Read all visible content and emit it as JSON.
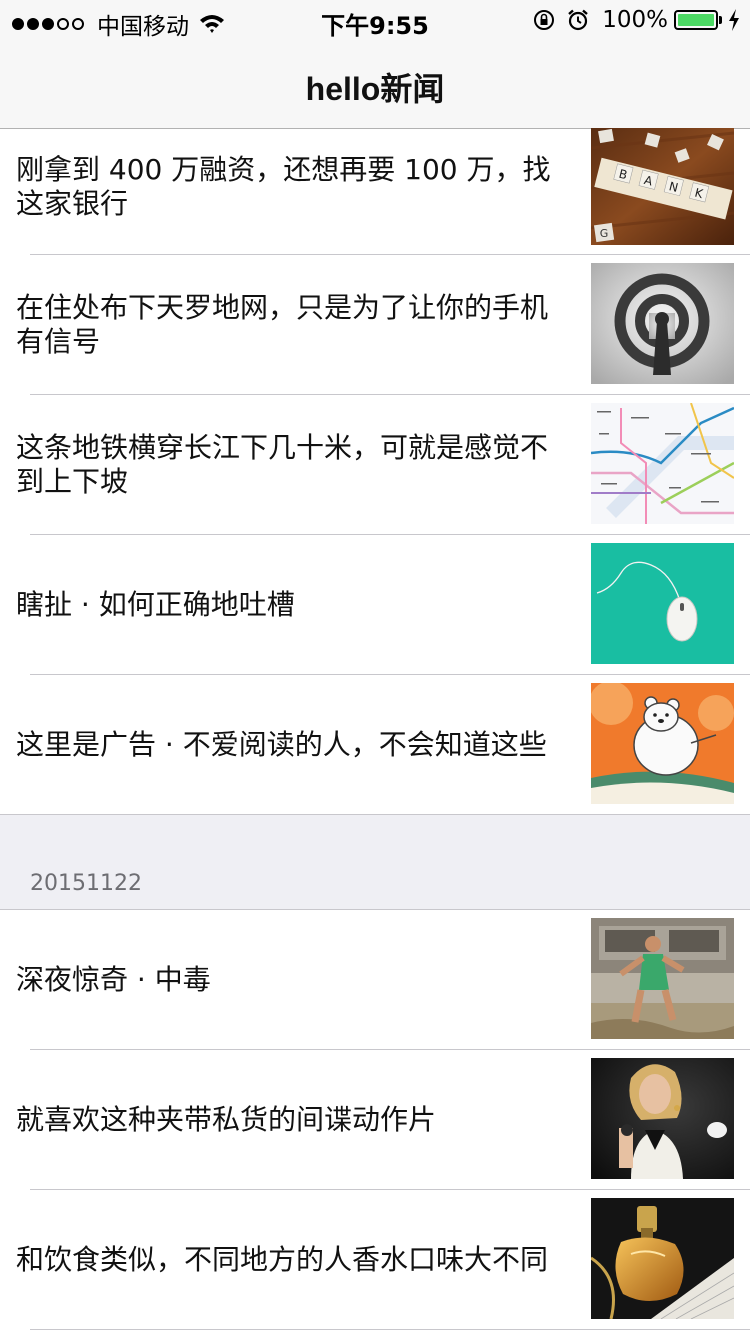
{
  "status_bar": {
    "carrier": "中国移动",
    "time": "下午9:55",
    "battery": "100%",
    "battery_level": 1.0,
    "signal_bars": 3,
    "signal_total": 5,
    "battery_color": "#4cd964"
  },
  "nav": {
    "title": "hello新闻"
  },
  "sections": [
    {
      "header": "",
      "items": [
        {
          "title": "刚拿到 400 万融资，还想再要 100 万，找这家银行",
          "thumb": "bank-tiles-image"
        },
        {
          "title": "在住处布下天罗地网，只是为了让你的手机有信号",
          "thumb": "signal-antenna-image"
        },
        {
          "title": "这条地铁横穿长江下几十米，可就是感觉不到上下坡",
          "thumb": "subway-map-image"
        },
        {
          "title": "瞎扯 · 如何正确地吐槽",
          "thumb": "computer-mouse-image"
        },
        {
          "title": "这里是广告 · 不爱阅读的人，不会知道这些",
          "thumb": "polar-bear-illustration"
        }
      ]
    },
    {
      "header": "20151122",
      "items": [
        {
          "title": "深夜惊奇 · 中毒",
          "thumb": "running-man-photo"
        },
        {
          "title": "就喜欢这种夹带私货的间谍动作片",
          "thumb": "woman-portrait-photo"
        },
        {
          "title": "和饮食类似，不同地方的人香水口味大不同",
          "thumb": "perfume-bottle-photo"
        }
      ]
    }
  ],
  "colors": {
    "bar_background": "#f7f7f7",
    "section_background": "#efeff4",
    "separator": "#c8c7cc",
    "section_text": "#6d6d72"
  }
}
